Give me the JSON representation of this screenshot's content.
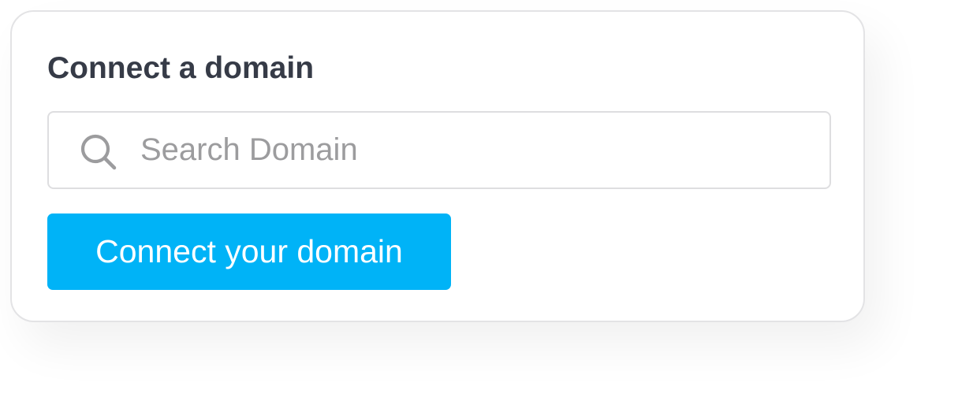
{
  "card": {
    "title": "Connect a domain",
    "search": {
      "placeholder": "Search Domain",
      "value": "",
      "icon": "search-icon"
    },
    "connect_button_label": "Connect your domain"
  },
  "colors": {
    "accent": "#00b3f7",
    "title_text": "#363b47",
    "placeholder_text": "#9c9c9e",
    "border": "#dedee0"
  }
}
